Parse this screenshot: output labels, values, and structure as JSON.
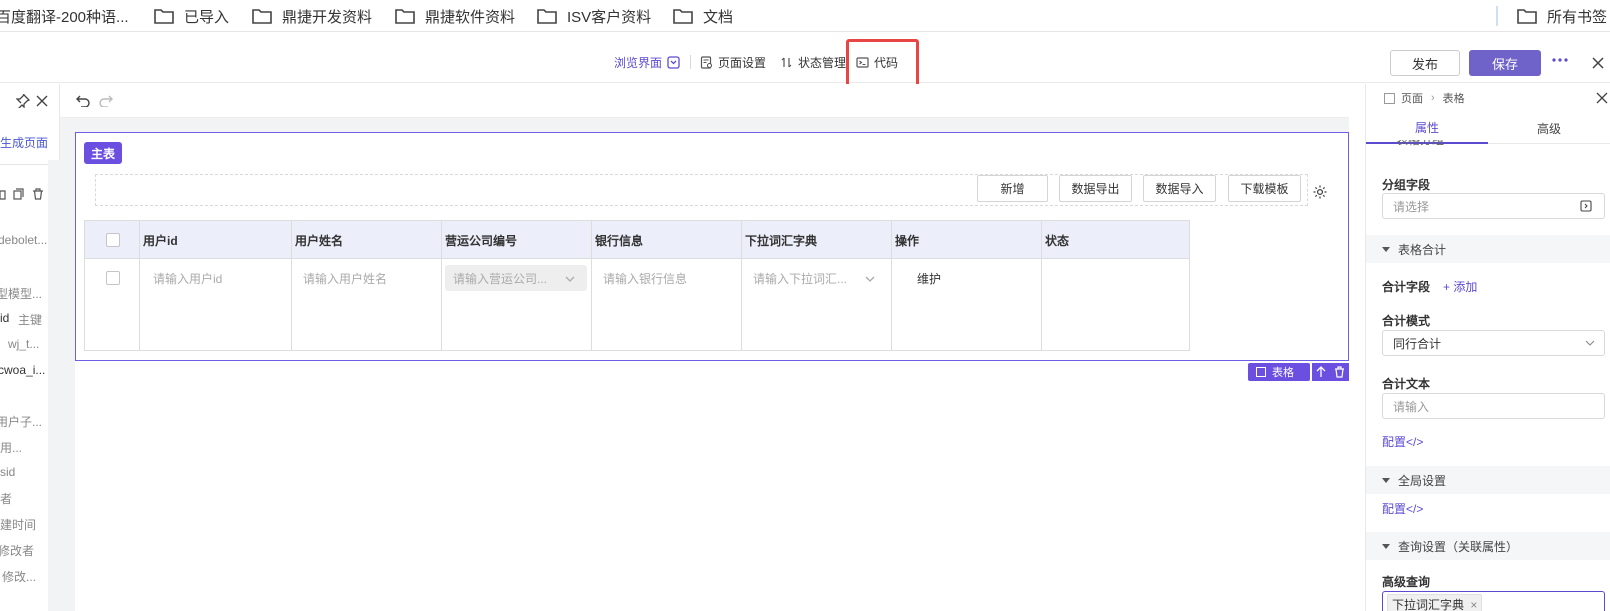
{
  "bookmarks": {
    "items": [
      {
        "label": "百度翻译-200种语..."
      },
      {
        "label": "已导入"
      },
      {
        "label": "鼎捷开发资料"
      },
      {
        "label": "鼎捷软件资料"
      },
      {
        "label": "ISV客户资料"
      },
      {
        "label": "文档"
      }
    ],
    "all_bookmarks": "所有书签"
  },
  "toolbar": {
    "browse": "浏览界面",
    "page_settings": "页面设置",
    "state_mgmt": "状态管理",
    "code": "代码",
    "publish": "发布",
    "save": "保存"
  },
  "left_panel": {
    "generate_page": "生成页面",
    "lines": [
      "debolet...",
      "型模型...",
      "id",
      "主键",
      "wj_t...",
      "cwoa_i...",
      "用户子...",
      "用...",
      "sid",
      "者",
      "建时间",
      "修改者",
      "修改..."
    ]
  },
  "canvas": {
    "main_tag": "主表",
    "buttons": [
      "新增",
      "数据导出",
      "数据导入",
      "下载模板"
    ],
    "columns": [
      "用户id",
      "用户姓名",
      "营运公司编号",
      "银行信息",
      "下拉词汇字典",
      "操作",
      "状态"
    ],
    "row": {
      "user_id_ph": "请输入用户id",
      "user_name_ph": "请输入用户姓名",
      "company_ph": "请输入营运公司...",
      "bank_ph": "请输入银行信息",
      "dict_ph": "请输入下拉词汇...",
      "action": "维护"
    },
    "component_badge": "表格"
  },
  "right_panel": {
    "breadcrumb": [
      "页面",
      "表格"
    ],
    "tabs": [
      "属性",
      "高级"
    ],
    "partial_section": "表格分组",
    "group_field_label": "分组字段",
    "group_field_ph": "请选择",
    "table_total_section": "表格合计",
    "total_field_label": "合计字段",
    "add_label": "+ 添加",
    "total_mode_label": "合计模式",
    "total_mode_value": "同行合计",
    "total_text_label": "合计文本",
    "total_text_ph": "请输入",
    "config_link": "配置</>",
    "global_section": "全局设置",
    "global_config_link": "配置</>",
    "query_section": "查询设置（关联属性）",
    "advanced_query_label": "高级查询",
    "advanced_query_tag": "下拉词汇字典"
  },
  "colors": {
    "accent": "#5b4bd1",
    "accent_fill": "#6b4fe0",
    "highlight": "#e84545"
  }
}
